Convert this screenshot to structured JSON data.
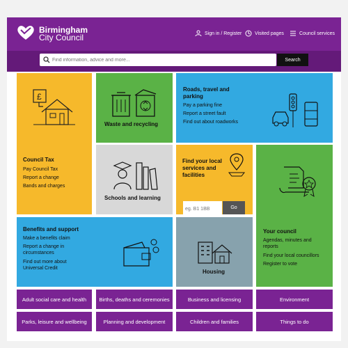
{
  "header": {
    "logo_line1": "Birmingham",
    "logo_line2": "City Council",
    "links": [
      "Sign in / Register",
      "Visited pages",
      "Council services"
    ]
  },
  "search": {
    "placeholder": "Find information, advice and more...",
    "button_label": "Search"
  },
  "tiles": {
    "council_tax": {
      "title": "Council Tax",
      "links": [
        "Pay Council Tax",
        "Report a change",
        "Bands and charges"
      ]
    },
    "waste": {
      "title": "Waste and recycling"
    },
    "roads": {
      "title_line1": "Roads, travel and",
      "title_line2": "parking",
      "links": [
        "Pay a parking fine",
        "Report a street fault",
        "Find out about roadworks"
      ]
    },
    "schools": {
      "title": "Schools and learning"
    },
    "local_services": {
      "title_line1": "Find your local",
      "title_line2": "services and",
      "title_line3": "facilities",
      "postcode_placeholder": "eg. B1 1BB",
      "go_label": "Go"
    },
    "your_council": {
      "title": "Your council",
      "links": [
        "Agendas, minutes and",
        "reports",
        "Find your local councillors",
        "Register to vote"
      ]
    },
    "benefits": {
      "title": "Benefits and support",
      "links": [
        "Make a benefits claim",
        "Report a change in",
        "circumstances",
        "Find out more about",
        "Universal Credit"
      ]
    },
    "housing": {
      "title": "Housing"
    }
  },
  "categories": [
    "Adult social care and health",
    "Births, deaths and ceremonies",
    "Business and licensing",
    "Environment",
    "Parks, leisure and wellbeing",
    "Planning and development",
    "Children and families",
    "Things to do"
  ],
  "colors": {
    "brand_purple": "#7a2393",
    "yellow": "#f6b92b",
    "green": "#5ab246",
    "blue": "#32a9e1",
    "grey": "#d8d8d8",
    "slate": "#87a2ad"
  }
}
